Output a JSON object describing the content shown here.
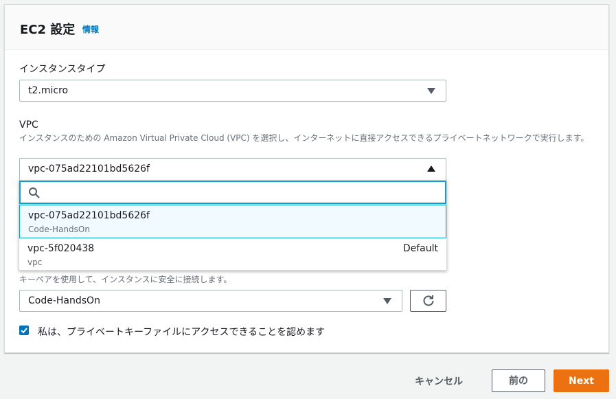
{
  "panel": {
    "title": "EC2 設定",
    "info_link": "情報"
  },
  "instance_type": {
    "label": "インスタンスタイプ",
    "value": "t2.micro"
  },
  "vpc": {
    "label": "VPC",
    "description": "インスタンスのための Amazon Virtual Private Cloud (VPC) を選択し、インターネットに直接アクセスできるプライベートネットワークで実行します。",
    "value": "vpc-075ad22101bd5626f",
    "search_placeholder": "",
    "options": [
      {
        "id": "vpc-075ad22101bd5626f",
        "name": "Code-HandsOn",
        "tag": ""
      },
      {
        "id": "vpc-5f020438",
        "name": "vpc",
        "tag": "Default"
      }
    ]
  },
  "keypair": {
    "description": "キーペアを使用して、インスタンスに安全に接続します。",
    "value": "Code-HandsOn"
  },
  "acknowledge": {
    "checked": true,
    "label": "私は、プライベートキーファイルにアクセスできることを認めます"
  },
  "footer": {
    "cancel": "キャンセル",
    "previous": "前の",
    "next": "Next"
  },
  "colors": {
    "primary": "#ec7211",
    "link": "#0073bb",
    "focus": "#0f9ec9"
  },
  "icons": [
    "search-icon",
    "refresh-icon",
    "checkmark-icon",
    "caret-down-icon",
    "caret-up-icon"
  ]
}
